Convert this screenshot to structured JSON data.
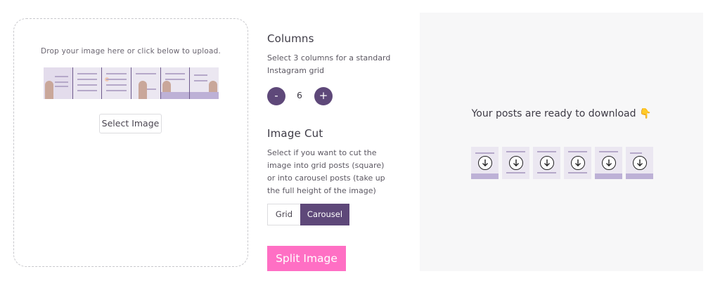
{
  "upload": {
    "drop_text": "Drop your image here or click below to upload.",
    "select_label": "Select Image",
    "strip_tiles": 6
  },
  "columns": {
    "heading": "Columns",
    "description": "Select 3 columns for a standard Instagram grid",
    "minus_label": "-",
    "plus_label": "+",
    "count": "6"
  },
  "image_cut": {
    "heading": "Image Cut",
    "description": "Select if you want to cut the image into grid posts (square) or into carousel posts (take up the full height of the image)",
    "options": [
      {
        "label": "Grid",
        "selected": false
      },
      {
        "label": "Carousel",
        "selected": true
      }
    ]
  },
  "split_button": {
    "label": "Split Image"
  },
  "preview": {
    "ready_text": "Your posts are ready to download",
    "ready_emoji": "👇",
    "post_count": 6
  },
  "colors": {
    "accent": "#5e4879",
    "split": "#ff6fc4",
    "panel_bg": "#f7f7f8"
  }
}
